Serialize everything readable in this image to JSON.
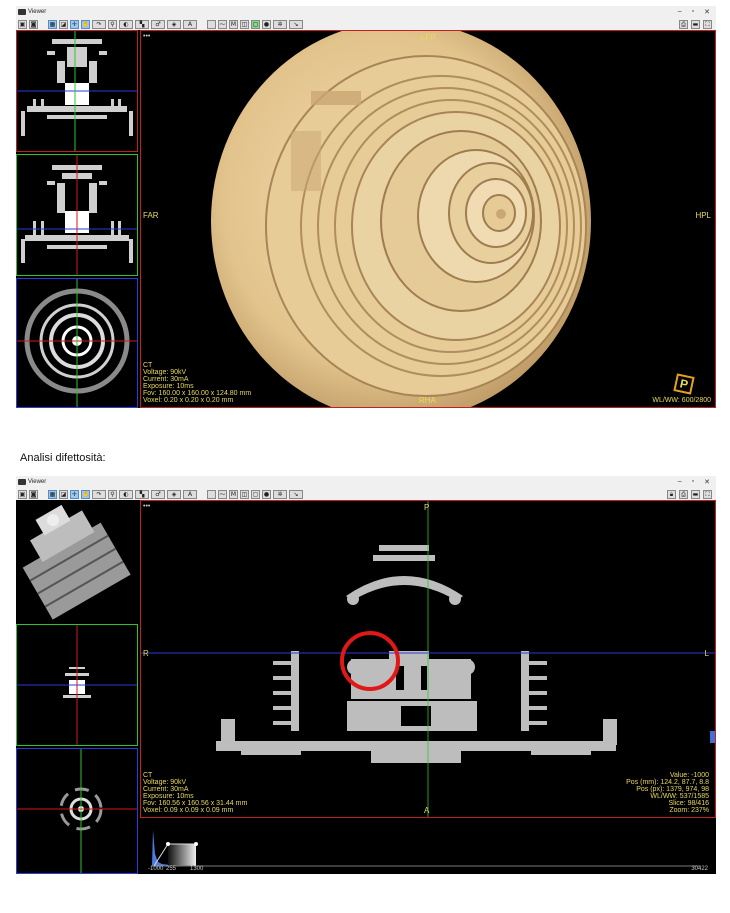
{
  "window": {
    "title": "Viewer",
    "controls": [
      "–",
      "▫",
      "✕"
    ]
  },
  "toolbar_icons": [
    "camera-icon",
    "capture-icon",
    "layout-icon",
    "image-icon",
    "crosshair-icon",
    "hand-icon",
    "rotate-icon",
    "zoom-icon",
    "contrast-icon",
    "grid-icon",
    "measure-icon",
    "layers-icon",
    "text-icon",
    "blank-icon",
    "curve-icon",
    "mip-icon",
    "cube-icon",
    "volume-icon",
    "sphere-icon",
    "settings-icon",
    "arrow-icon"
  ],
  "top_view": {
    "orient": {
      "top": "LFP",
      "left": "FAR",
      "right": "HPL",
      "bottom": "RHA"
    },
    "info": [
      "CT",
      "Voltage: 90kV",
      "Current: 30mA",
      "Exposure: 10ms",
      "Fov: 160.00 x 160.00 x 124.80 mm",
      "Voxel: 0.20 x 0.20 x 0.20 mm"
    ],
    "wlww": "WL/WW: 600/2800",
    "cube_letter": "P",
    "dots": "•••"
  },
  "caption": "Analisi difettosità:",
  "bottom_view": {
    "orient": {
      "top": "P",
      "left": "R",
      "right": "L",
      "bottom": "A"
    },
    "info": [
      "CT",
      "Voltage: 90kV",
      "Current: 30mA",
      "Exposure: 10ms",
      "Fov: 160.56 x 160.56 x 31.44 mm",
      "Voxel: 0.09 x 0.09 x 0.09 mm"
    ],
    "readout": [
      "Value: -1000",
      "Pos (mm): 124.2, 87.7, 8.8",
      "Pos (px): 1379, 974, 98",
      "WL/WW: 537/1585",
      "Slice: 98/416",
      "Zoom: 237%"
    ],
    "dots": "•••",
    "histogram_labels": {
      "a": "-1000",
      "b": "255",
      "c": "1300",
      "max": "30422"
    }
  },
  "colors": {
    "annotation": "#e8d860",
    "defect_circle": "#e01818",
    "crosshair_green": "#2ec42e",
    "crosshair_blue": "#2a3cdc",
    "crosshair_red": "#d01818"
  }
}
